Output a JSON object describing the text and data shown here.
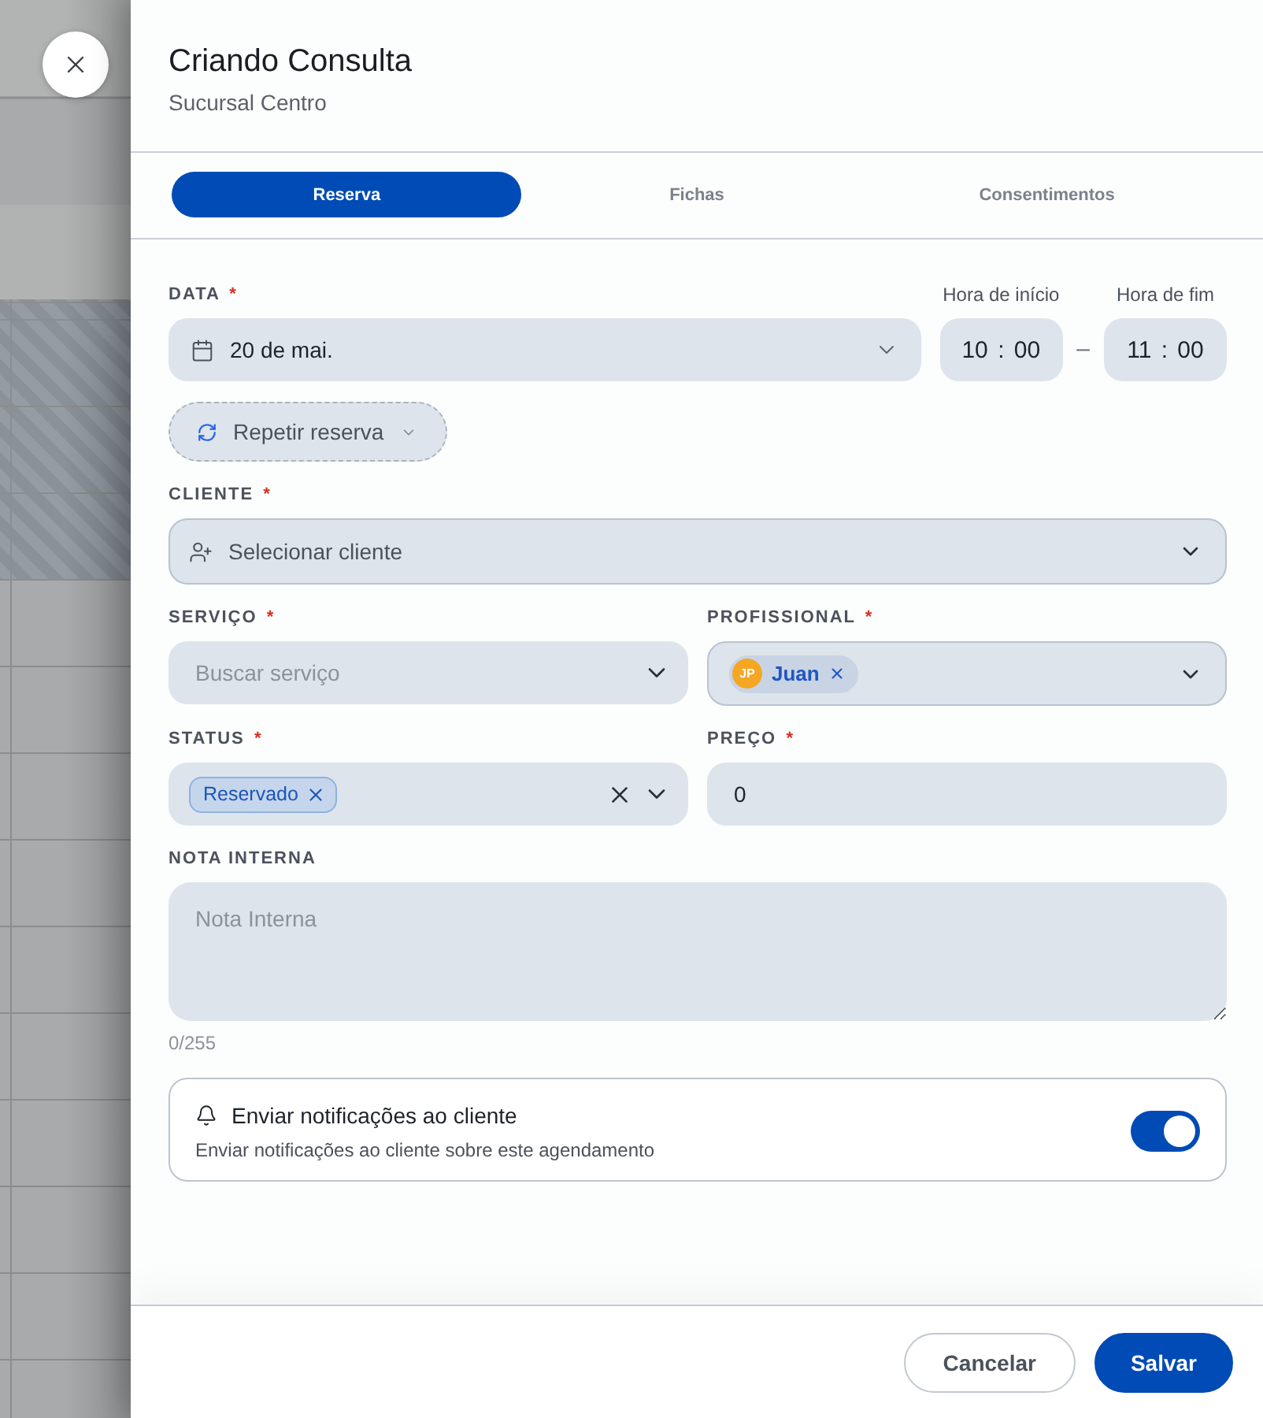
{
  "header": {
    "title": "Criando Consulta",
    "subtitle": "Sucursal Centro"
  },
  "tabs": [
    {
      "label": "Reserva",
      "selected": true
    },
    {
      "label": "Fichas",
      "selected": false
    },
    {
      "label": "Consentimentos",
      "selected": false
    }
  ],
  "date": {
    "label": "DATA",
    "required_mark": "*",
    "value": "20 de mai."
  },
  "times": [
    {
      "label": "Hora de início",
      "hour": "10",
      "separator": ":",
      "minute": "00"
    },
    {
      "label": "Hora de fim",
      "hour": "11",
      "separator": ":",
      "minute": "00"
    }
  ],
  "time_range_separator": "–",
  "repeat_button": {
    "label": "Repetir reserva"
  },
  "client": {
    "label": "CLIENTE",
    "required_mark": "*",
    "placeholder": "Selecionar cliente"
  },
  "service": {
    "label": "SERVIÇO",
    "required_mark": "*",
    "placeholder": "Buscar serviço"
  },
  "professional": {
    "label": "PROFISSIONAL",
    "required_mark": "*",
    "chips": [
      {
        "initials": "JP",
        "name": "Juan"
      }
    ]
  },
  "status": {
    "label": "STATUS",
    "required_mark": "*",
    "chips": [
      {
        "label": "Reservado"
      }
    ]
  },
  "price": {
    "label": "PREÇO",
    "required_mark": "*",
    "value": "0"
  },
  "note": {
    "label": "NOTA INTERNA",
    "placeholder": "Nota Interna",
    "counter": "0/255"
  },
  "notification": {
    "title": "Enviar notificações ao cliente",
    "description": "Enviar notificações ao cliente sobre este agendamento",
    "on": true
  },
  "footer": {
    "buttons": [
      {
        "label": "Cancelar",
        "kind": "secondary"
      },
      {
        "label": "Salvar",
        "kind": "primary"
      }
    ]
  }
}
